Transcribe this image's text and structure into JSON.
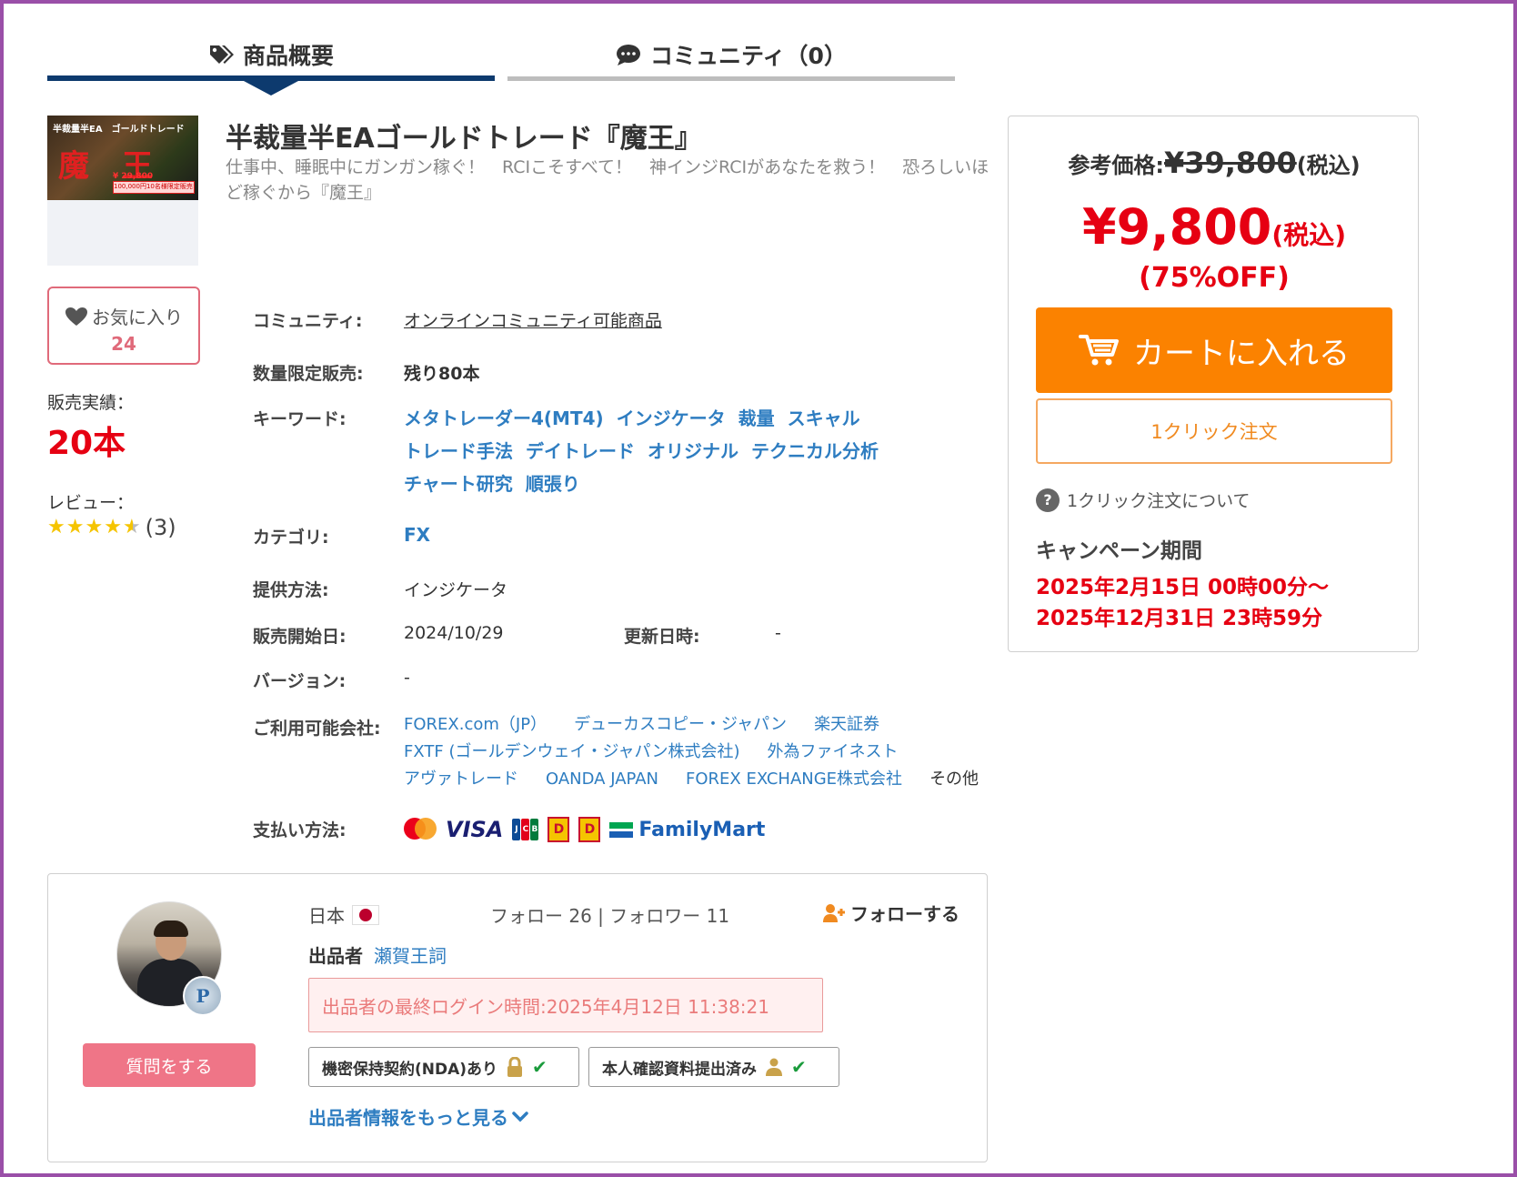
{
  "tabs": {
    "overview": "商品概要",
    "community": "コミュニティ（0）"
  },
  "product": {
    "thumbnail_text": {
      "banner": "半裁量半EA　ゴールドトレード",
      "logo": "魔王",
      "price": "¥ 29,800",
      "promo": "100,000円10名様限定販売!"
    },
    "title": "半裁量半EAゴールドトレード『魔王』",
    "subtitle": "仕事中、睡眠中にガンガン稼ぐ！　RCIこそすべて！　神インジRCIがあなたを救う！　恐ろしいほど稼ぐから『魔王』"
  },
  "left": {
    "favorite_label": "お気に入り",
    "favorite_count": "24",
    "sales_label": "販売実績：",
    "sales_value": "20本",
    "review_label": "レビュー：",
    "review_rating": 4.5,
    "review_count": "(3)"
  },
  "specs": {
    "community_label": "コミュニティ:",
    "community_value": "オンラインコミュニティ可能商品",
    "limited_label": "数量限定販売:",
    "limited_value": "残り80本",
    "keywords_label": "キーワード:",
    "keywords": [
      "メタトレーダー4(MT4)",
      "インジケータ",
      "裁量",
      "スキャル",
      "トレード手法",
      "デイトレード",
      "オリジナル",
      "テクニカル分析",
      "チャート研究",
      "順張り"
    ],
    "category_label": "カテゴリ:",
    "category_value": "FX",
    "delivery_label": "提供方法:",
    "delivery_value": "インジケータ",
    "release_label": "販売開始日:",
    "release_value": "2024/10/29",
    "updated_label": "更新日時:",
    "updated_value": "-",
    "version_label": "バージョン:",
    "version_value": "-",
    "brokers_label": "ご利用可能会社:",
    "brokers": [
      "FOREX.com（JP）",
      "デューカスコピー・ジャパン",
      "楽天証券",
      "FXTF (ゴールデンウェイ・ジャパン株式会社)",
      "外為ファイネスト",
      "アヴァトレード",
      "OANDA JAPAN",
      "FOREX EXCHANGE株式会社"
    ],
    "brokers_other": "その他",
    "payment_label": "支払い方法:",
    "payment": {
      "visa": "VISA",
      "mastercard": "mastercard",
      "jcb": "JCB",
      "daily": "D",
      "familymart": "FamilyMart"
    }
  },
  "price": {
    "ref_label": "参考価格:",
    "ref_price": "¥39,800",
    "ref_tax": "(税込)",
    "sale_price": "¥9,800",
    "sale_tax": "(税込)",
    "discount": "(75%OFF)",
    "cart_button": "カートに入れる",
    "oneclick_button": "1クリック注文",
    "oneclick_help": "1クリック注文について",
    "campaign_title": "キャンペーン期間",
    "campaign_start": "2025年2月15日 00時00分～",
    "campaign_end": "2025年12月31日 23時59分"
  },
  "seller": {
    "country": "日本",
    "follow_stats": "フォロー 26 | フォロワー 11",
    "follow_button": "フォローする",
    "seller_label": "出品者",
    "seller_name": "瀬賀王詞",
    "last_login": "出品者の最終ログイン時間:2025年4月12日 11:38:21",
    "nda": "機密保持契約(NDA)あり",
    "identity": "本人確認資料提出済み",
    "ask_button": "質問をする",
    "more_link": "出品者情報をもっと見る",
    "badge": "P"
  },
  "colors": {
    "accent_red": "#e60012",
    "cart_orange": "#fb8200",
    "link_blue": "#2e7dc1",
    "tab_navy": "#0d3a6e",
    "frame_purple": "#9a4fa8"
  }
}
